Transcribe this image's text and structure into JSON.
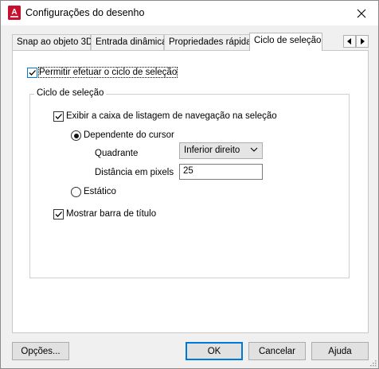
{
  "window": {
    "title": "Configurações do desenho",
    "icon_letter": "A",
    "icon_color": "#c8102e"
  },
  "tabs": [
    {
      "label": "Snap ao objeto 3D",
      "active": false
    },
    {
      "label": "Entrada dinâmica",
      "active": false
    },
    {
      "label": "Propriedades rápidas",
      "active": false
    },
    {
      "label": "Ciclo de seleção",
      "active": true
    }
  ],
  "panel": {
    "allow_cycling_label": "Permitir efetuar o ciclo de seleção",
    "allow_cycling_checked": true,
    "group_title": "Ciclo de seleção",
    "show_listbox_label": "Exibir a caixa de listagem de navegação na seleção",
    "show_listbox_checked": true,
    "cursor_dependent_label": "Dependente do cursor",
    "cursor_dependent_selected": true,
    "quadrant_label": "Quadrante",
    "quadrant_value": "Inferior direito",
    "distance_label": "Distância em pixels",
    "distance_value": "25",
    "static_label": "Estático",
    "static_selected": false,
    "show_titlebar_label": "Mostrar barra de título",
    "show_titlebar_checked": true
  },
  "buttons": {
    "options": "Opções...",
    "ok": "OK",
    "cancel": "Cancelar",
    "help": "Ajuda"
  },
  "colors": {
    "accent": "#0078d7",
    "checkbox_focus": "#0078d7"
  }
}
